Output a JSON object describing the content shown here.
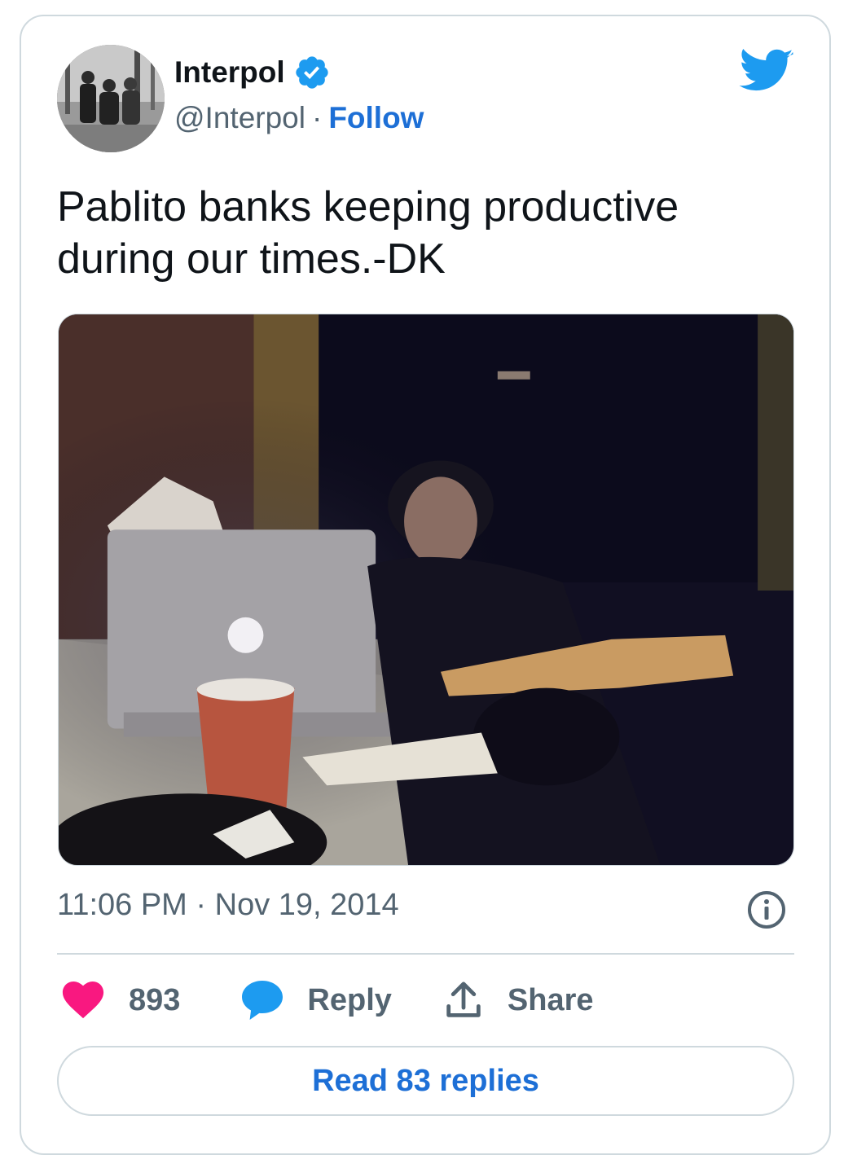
{
  "author": {
    "display_name": "Interpol",
    "handle": "@Interpol",
    "separator": "·",
    "follow_label": "Follow",
    "verified": true
  },
  "tweet": {
    "text": "Pablito banks keeping productive during our times.-DK",
    "time": "11:06 PM",
    "date": "Nov 19, 2014",
    "date_separator": "·"
  },
  "actions": {
    "like_count": "893",
    "reply_label": "Reply",
    "share_label": "Share",
    "read_replies_label": "Read 83 replies"
  },
  "icons": {
    "brand": "twitter-bird-icon",
    "verified": "verified-badge-icon",
    "like": "heart-icon",
    "reply": "speech-bubble-icon",
    "share": "upload-arrow-icon",
    "info": "info-icon"
  },
  "colors": {
    "twitter_blue": "#1d9bf0",
    "link_blue": "#1d6fd6",
    "like_pink": "#f91880",
    "muted_text": "#536471",
    "border": "#cfd9de"
  }
}
